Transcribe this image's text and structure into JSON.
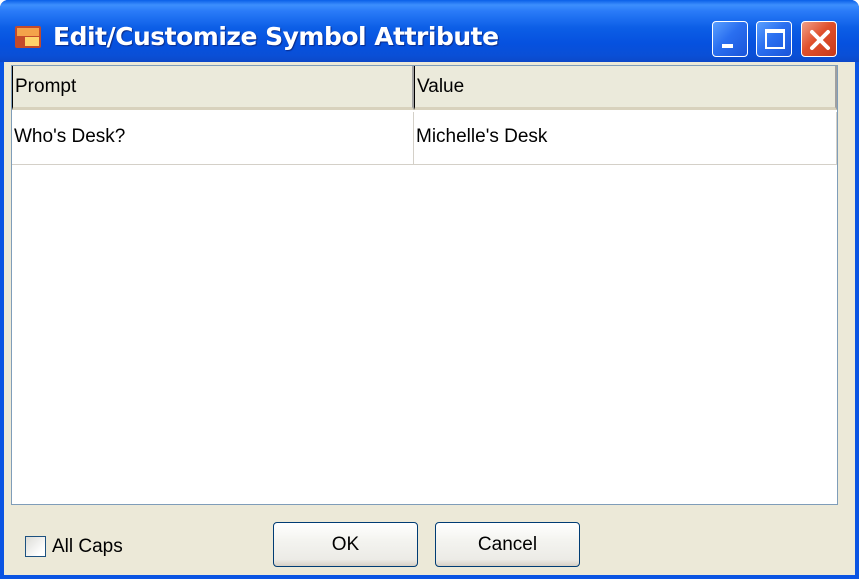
{
  "window": {
    "title": "Edit/Customize Symbol Attribute",
    "controls": {
      "minimize": "minimize",
      "maximize": "maximize",
      "close": "close"
    },
    "icon": "app-icon"
  },
  "grid": {
    "columns": [
      "Prompt",
      "Value"
    ],
    "rows": [
      {
        "prompt": "Who's Desk?",
        "value": "Michelle's Desk"
      }
    ]
  },
  "footer": {
    "all_caps_label": "All Caps",
    "all_caps_checked": false,
    "ok_label": "OK",
    "cancel_label": "Cancel"
  },
  "colors": {
    "titlebar": "#0a54e3",
    "client": "#ece9d8",
    "header": "#ebeadb"
  }
}
